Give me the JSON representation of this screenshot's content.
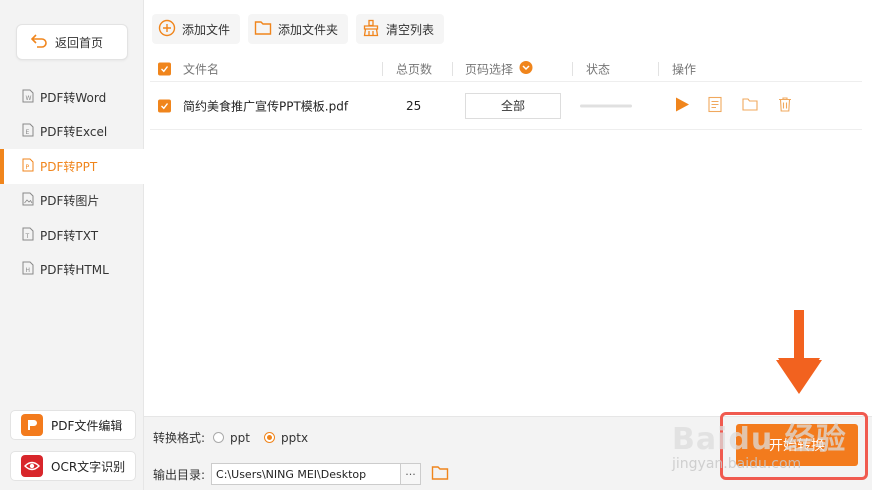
{
  "sidebar": {
    "back_label": "返回首页",
    "items": [
      {
        "label": "PDF转Word",
        "icon": "word-doc-icon",
        "letter": "W"
      },
      {
        "label": "PDF转Excel",
        "icon": "excel-doc-icon",
        "letter": "E"
      },
      {
        "label": "PDF转PPT",
        "icon": "ppt-doc-icon",
        "letter": "P",
        "active": true
      },
      {
        "label": "PDF转图片",
        "icon": "image-doc-icon",
        "letter": ""
      },
      {
        "label": "PDF转TXT",
        "icon": "txt-doc-icon",
        "letter": "T"
      },
      {
        "label": "PDF转HTML",
        "icon": "html-doc-icon",
        "letter": "H"
      }
    ],
    "pdf_edit_label": "PDF文件编辑",
    "ocr_label": "OCR文字识别"
  },
  "toolbar": {
    "add_file": "添加文件",
    "add_folder": "添加文件夹",
    "clear_list": "清空列表"
  },
  "table": {
    "headers": {
      "filename": "文件名",
      "total_pages": "总页数",
      "page_select": "页码选择",
      "status": "状态",
      "actions": "操作"
    },
    "rows": [
      {
        "filename": "简约美食推广宣传PPT模板.pdf",
        "pages": "25",
        "page_select": "全部",
        "progress": 0
      }
    ]
  },
  "bottom": {
    "format_label": "转换格式:",
    "format_options": [
      "ppt",
      "pptx"
    ],
    "format_selected": "pptx",
    "output_label": "输出目录:",
    "output_path": "C:\\Users\\NING MEI\\Desktop",
    "dots": "···",
    "start_label": "开始转换"
  },
  "watermark": {
    "main": "Baidu 经验",
    "sub": "jingyan.baidu.com"
  },
  "colors": {
    "accent": "#f0851c",
    "start_button": "#f37b1d",
    "highlight": "#f05a4f",
    "arrow": "#f2621f"
  }
}
